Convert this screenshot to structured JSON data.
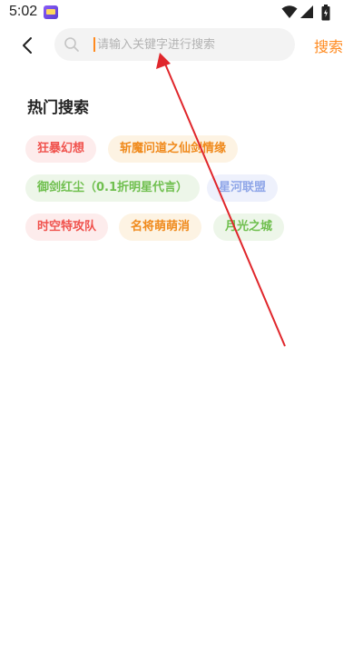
{
  "status_bar": {
    "time": "5:02",
    "icons": [
      "app-notification-icon",
      "wifi-icon",
      "signal-icon",
      "battery-icon"
    ]
  },
  "header": {
    "back_icon": "chevron-left-icon",
    "search_icon": "search-icon",
    "search_placeholder": "请输入关键字进行搜索",
    "search_value": "",
    "search_button_label": "搜索"
  },
  "hot_search": {
    "title": "热门搜索",
    "tags": [
      {
        "label": "狂暴幻想",
        "color": "#f0524d",
        "bg": "#fdecec"
      },
      {
        "label": "斩魔问道之仙剑情缘",
        "color": "#f08a1c",
        "bg": "#fdf3e3"
      },
      {
        "label": "御剑红尘（0.1折明星代言）",
        "color": "#6fbf4e",
        "bg": "#edf6e9"
      },
      {
        "label": "星河联盟",
        "color": "#8fa6e8",
        "bg": "#eef1fc"
      },
      {
        "label": "时空特攻队",
        "color": "#f0524d",
        "bg": "#fdecec"
      },
      {
        "label": "名将萌萌消",
        "color": "#f08a1c",
        "bg": "#fdf3e3"
      },
      {
        "label": "月光之城",
        "color": "#6fbf4e",
        "bg": "#edf6e9"
      }
    ]
  },
  "colors": {
    "accent": "#ff8a1f",
    "annotation_arrow": "#e0262b"
  }
}
